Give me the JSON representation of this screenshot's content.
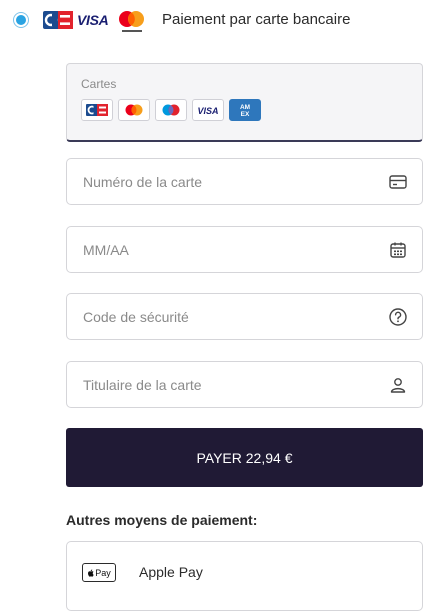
{
  "header": {
    "title": "Paiement par carte bancaire",
    "visa_text": "VISA",
    "selected": true,
    "logos": [
      "cb-logo",
      "visa-logo",
      "mastercard-logo"
    ]
  },
  "cards": {
    "label": "Cartes",
    "brands": [
      {
        "name": "cb",
        "text": "CB"
      },
      {
        "name": "mastercard",
        "text": ""
      },
      {
        "name": "maestro",
        "text": ""
      },
      {
        "name": "visa",
        "text": "VISA"
      },
      {
        "name": "amex",
        "text": "AM EX"
      }
    ]
  },
  "form": {
    "card_number": {
      "placeholder": "Numéro de la carte",
      "value": "",
      "icon": "credit-card-icon"
    },
    "expiry": {
      "placeholder": "MM/AA",
      "value": "",
      "icon": "calendar-icon"
    },
    "cvc": {
      "placeholder": "Code de sécurité",
      "value": "",
      "icon": "question-circle-icon"
    },
    "holder": {
      "placeholder": "Titulaire de la carte",
      "value": "",
      "icon": "user-icon"
    }
  },
  "pay_button": {
    "label": "PAYER 22,94 €"
  },
  "other_methods": {
    "title": "Autres moyens de paiement:",
    "items": [
      {
        "badge": "Pay",
        "label": "Apple Pay",
        "icon": "apple-icon"
      }
    ]
  },
  "colors": {
    "accent": "#2aa3e2",
    "pay_button": "#201a35",
    "cb_blue": "#1b4b8f",
    "cb_red": "#e2232d",
    "visa_blue": "#1a1f71",
    "mastercard_red": "#eb001b",
    "mastercard_orange": "#f79e1b",
    "amex_blue": "#2e77bc"
  }
}
